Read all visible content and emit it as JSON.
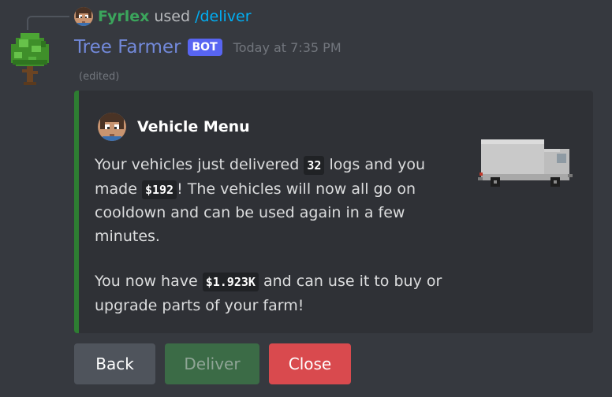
{
  "reply": {
    "username": "Fyrlex",
    "used_text": "used",
    "command": "/deliver"
  },
  "message": {
    "bot_name": "Tree Farmer",
    "bot_tag": "BOT",
    "timestamp": "Today at 7:35 PM",
    "edited": "(edited)"
  },
  "embed": {
    "accent_color": "#2e7d32",
    "author": "Vehicle Menu",
    "p1_a": "Your vehicles just delivered ",
    "logs": "32",
    "p1_b": " logs and you made ",
    "earned": "$192",
    "p1_c": "! The vehicles will now all go on cooldown and can be used again in a few minutes.",
    "p2_a": "You now have ",
    "balance": "$1.923K",
    "p2_b": " and can use it to buy or upgrade parts of your farm!",
    "thumbnail_icon": "truck-icon"
  },
  "buttons": {
    "back": "Back",
    "deliver": "Deliver",
    "close": "Close"
  }
}
